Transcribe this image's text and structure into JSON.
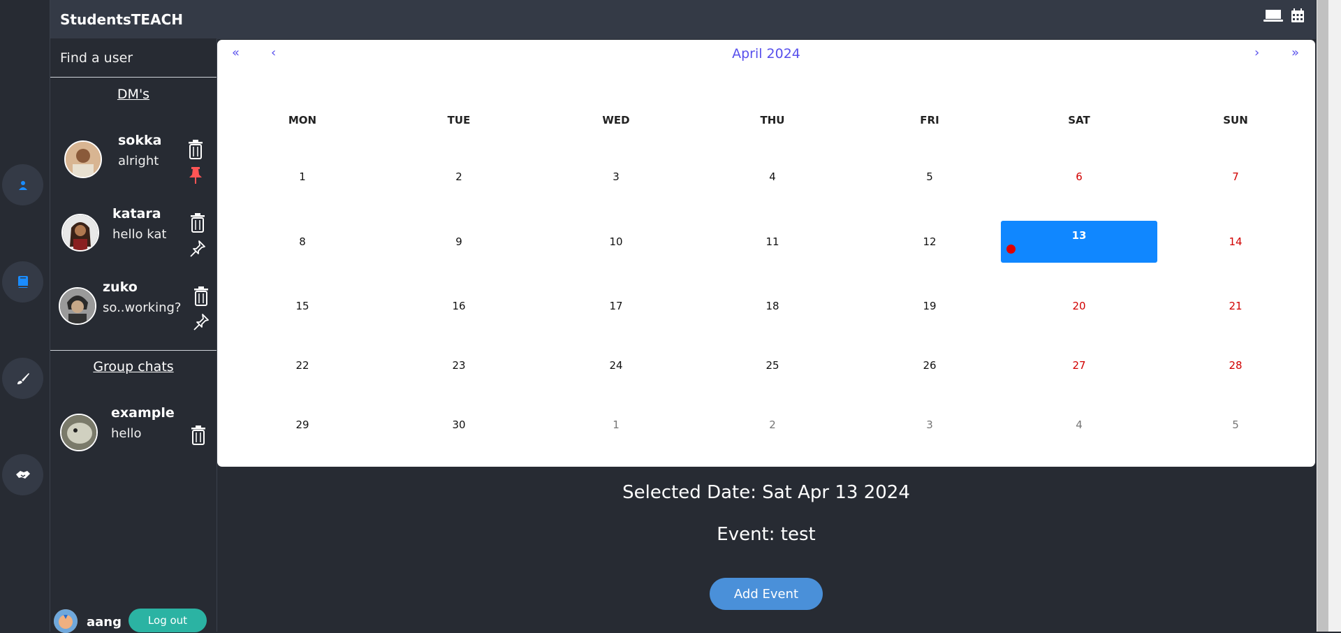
{
  "app": {
    "title": "StudentsTEACH"
  },
  "sidebar": {
    "find_user": "Find a user",
    "dm_title": "DM's",
    "dms": [
      {
        "name": "sokka",
        "message": "alright",
        "pinned": true
      },
      {
        "name": "katara",
        "message": "hello kat",
        "pinned": false
      },
      {
        "name": "zuko",
        "message": "so..working?",
        "pinned": false
      }
    ],
    "group_title": "Group chats",
    "groups": [
      {
        "name": "example",
        "message": "hello"
      }
    ],
    "current_user": "aang",
    "logout_label": "Log out"
  },
  "rail": {
    "icons": [
      "user-icon",
      "book-icon",
      "brush-icon",
      "handshake-icon"
    ],
    "accent": "#1a8cff"
  },
  "topbar": {
    "icons": [
      "laptop-icon",
      "calendar-icon"
    ]
  },
  "calendar": {
    "nav": {
      "prev_year": "«",
      "prev_month": "‹",
      "next_month": "›",
      "next_year": "»"
    },
    "month_label": "April 2024",
    "weekdays": [
      "MON",
      "TUE",
      "WED",
      "THU",
      "FRI",
      "SAT",
      "SUN"
    ],
    "weeks": [
      [
        "1",
        "2",
        "3",
        "4",
        "5",
        "6",
        "7"
      ],
      [
        "8",
        "9",
        "10",
        "11",
        "12",
        "13",
        "14"
      ],
      [
        "15",
        "16",
        "17",
        "18",
        "19",
        "20",
        "21"
      ],
      [
        "22",
        "23",
        "24",
        "25",
        "26",
        "27",
        "28"
      ],
      [
        "29",
        "30",
        "1",
        "2",
        "3",
        "4",
        "5"
      ]
    ],
    "selected_day": "13",
    "event_day": "13",
    "colors": {
      "nav": "#5850ec",
      "weekend": "#d10000",
      "selected": "#1087ff",
      "event_dot": "#e00000"
    }
  },
  "details": {
    "selected_date": "Selected Date: Sat Apr 13 2024",
    "event": "Event: test",
    "add_event_label": "Add Event"
  }
}
